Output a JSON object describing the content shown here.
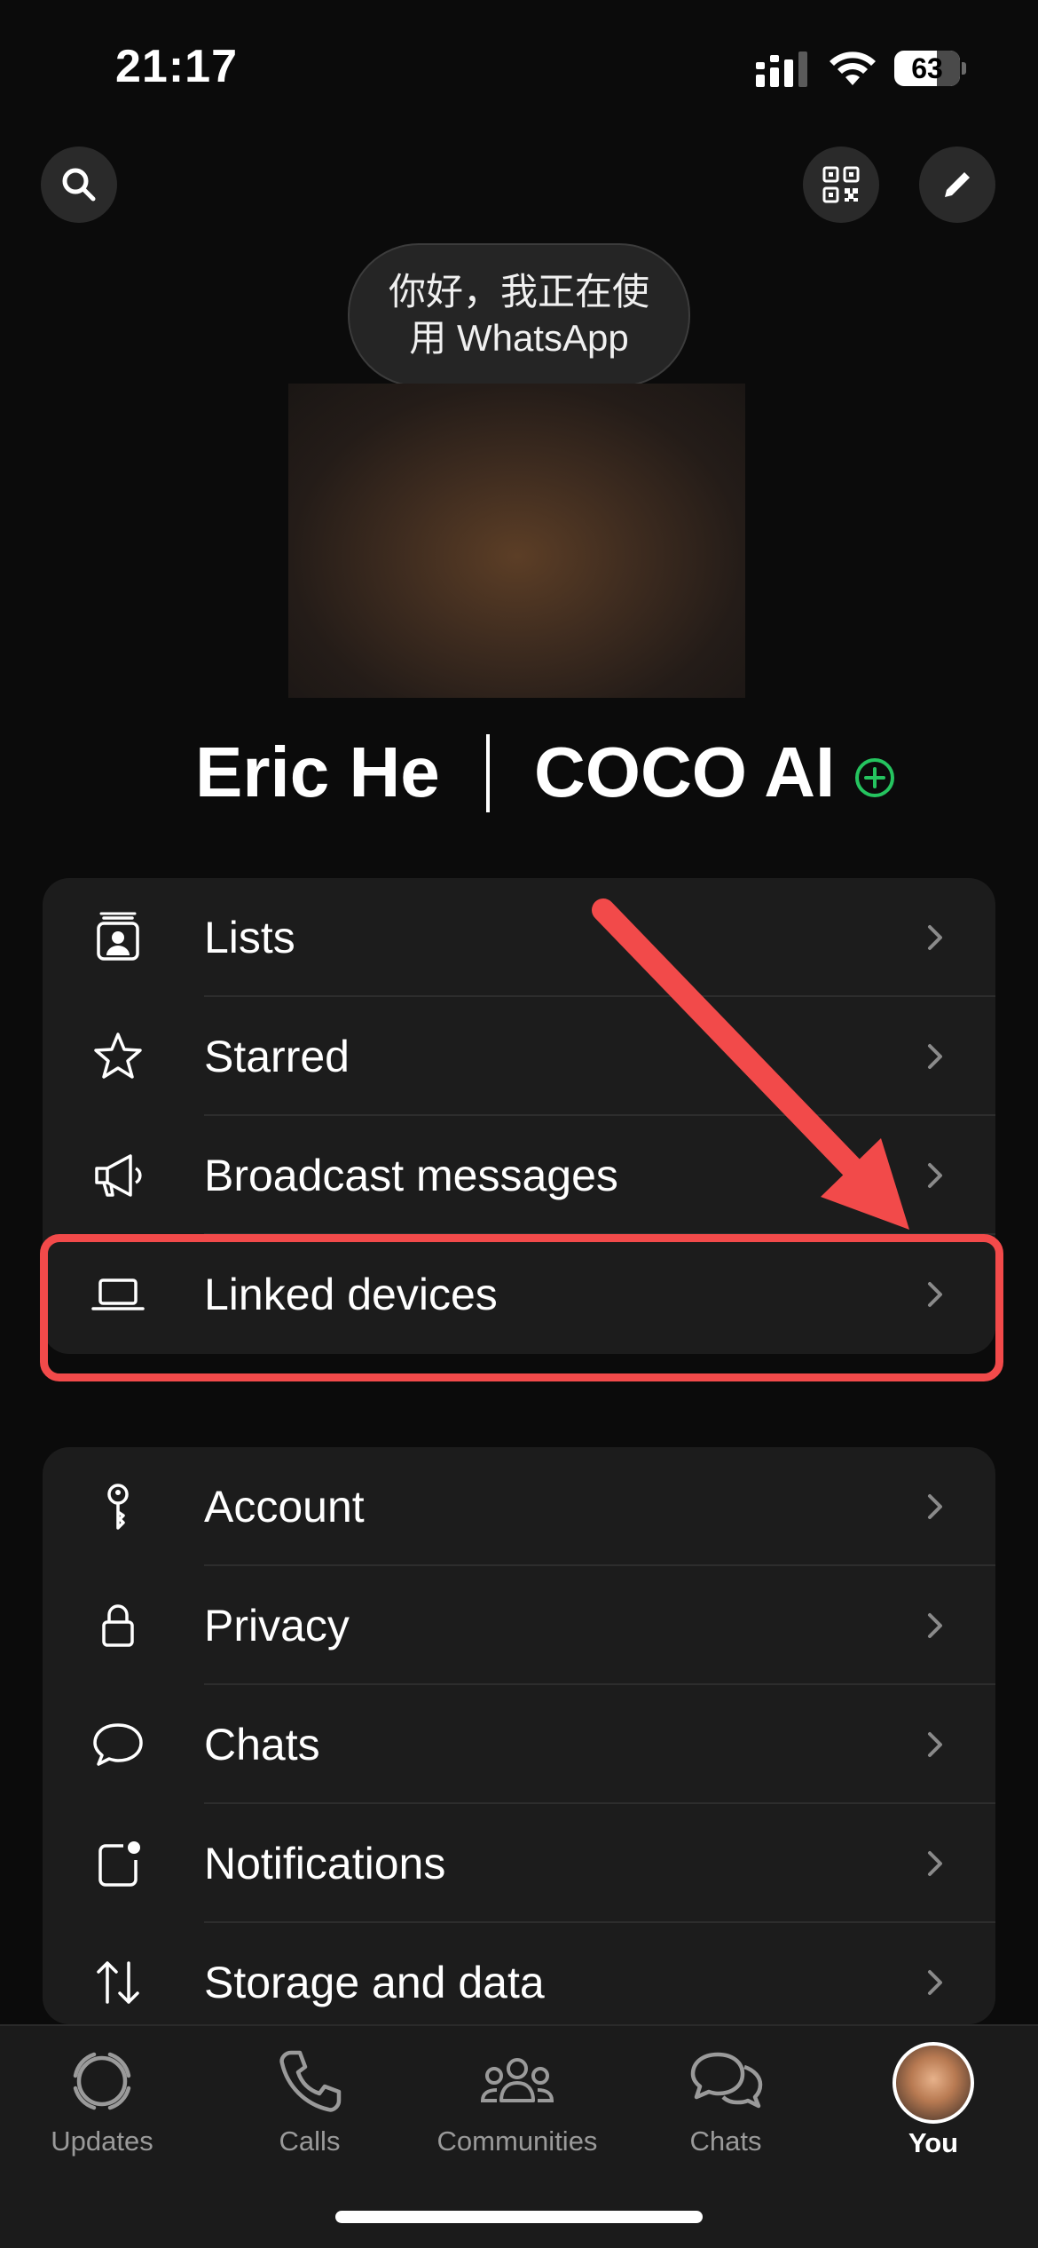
{
  "status_bar": {
    "time": "21:17",
    "battery": "63"
  },
  "header": {
    "search_icon": "search-icon",
    "qr_icon": "qr-code-icon",
    "edit_icon": "pencil-icon"
  },
  "profile": {
    "status_text": "你好，我正在使用 WhatsApp",
    "name_left": "Eric He",
    "name_right": "COCO AI"
  },
  "groups": [
    {
      "items": [
        {
          "label": "Lists",
          "icon": "lists-icon"
        },
        {
          "label": "Starred",
          "icon": "star-icon"
        },
        {
          "label": "Broadcast messages",
          "icon": "megaphone-icon"
        },
        {
          "label": "Linked devices",
          "icon": "laptop-icon"
        }
      ]
    },
    {
      "items": [
        {
          "label": "Account",
          "icon": "key-icon"
        },
        {
          "label": "Privacy",
          "icon": "lock-icon"
        },
        {
          "label": "Chats",
          "icon": "chat-bubble-icon"
        },
        {
          "label": "Notifications",
          "icon": "notification-icon"
        },
        {
          "label": "Storage and data",
          "icon": "up-down-arrows-icon"
        }
      ]
    }
  ],
  "annotation": {
    "color": "#f24a4a"
  },
  "tabs": [
    {
      "label": "Updates",
      "icon": "updates-icon"
    },
    {
      "label": "Calls",
      "icon": "phone-icon"
    },
    {
      "label": "Communities",
      "icon": "communities-icon"
    },
    {
      "label": "Chats",
      "icon": "chats-icon"
    },
    {
      "label": "You",
      "icon": "avatar",
      "active": true
    }
  ]
}
